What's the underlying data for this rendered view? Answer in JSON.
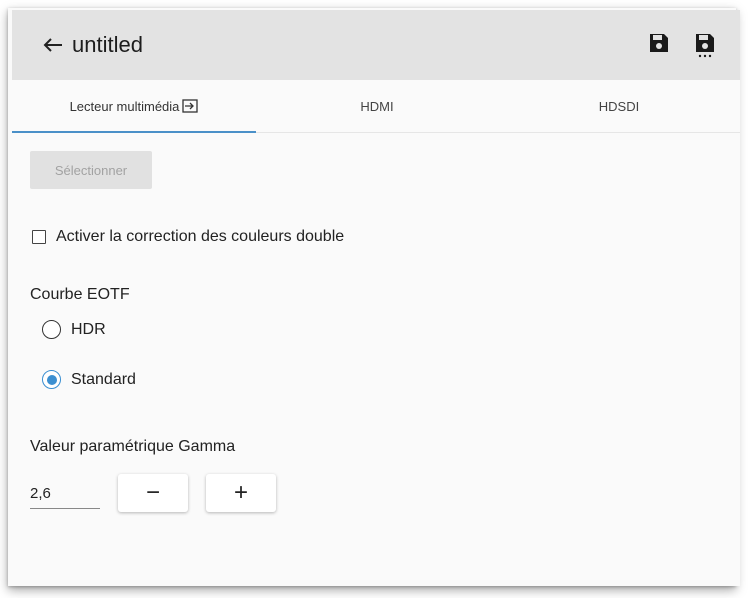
{
  "header": {
    "title": "untitled",
    "back_icon": "arrow-left-icon",
    "save_icon": "floppy-save-icon",
    "save_as_icon": "floppy-save-as-icon",
    "bg_color": "#e3e3e3"
  },
  "tabs": [
    {
      "label": "Lecteur multimédia",
      "icon": "open-external-icon",
      "active": true
    },
    {
      "label": "HDMI",
      "active": false
    },
    {
      "label": "HDSDI",
      "active": false
    }
  ],
  "accent_color": "#3b8fd1",
  "select_button": {
    "label": "Sélectionner",
    "disabled": true
  },
  "checkbox": {
    "label": "Activer la correction des couleurs double",
    "checked": false
  },
  "eotf": {
    "title": "Courbe EOTF",
    "options": [
      {
        "label": "HDR",
        "checked": false
      },
      {
        "label": "Standard",
        "checked": true
      }
    ]
  },
  "gamma": {
    "title": "Valeur paramétrique Gamma",
    "value": "2,6",
    "decrement_label": "−",
    "increment_label": "+"
  }
}
